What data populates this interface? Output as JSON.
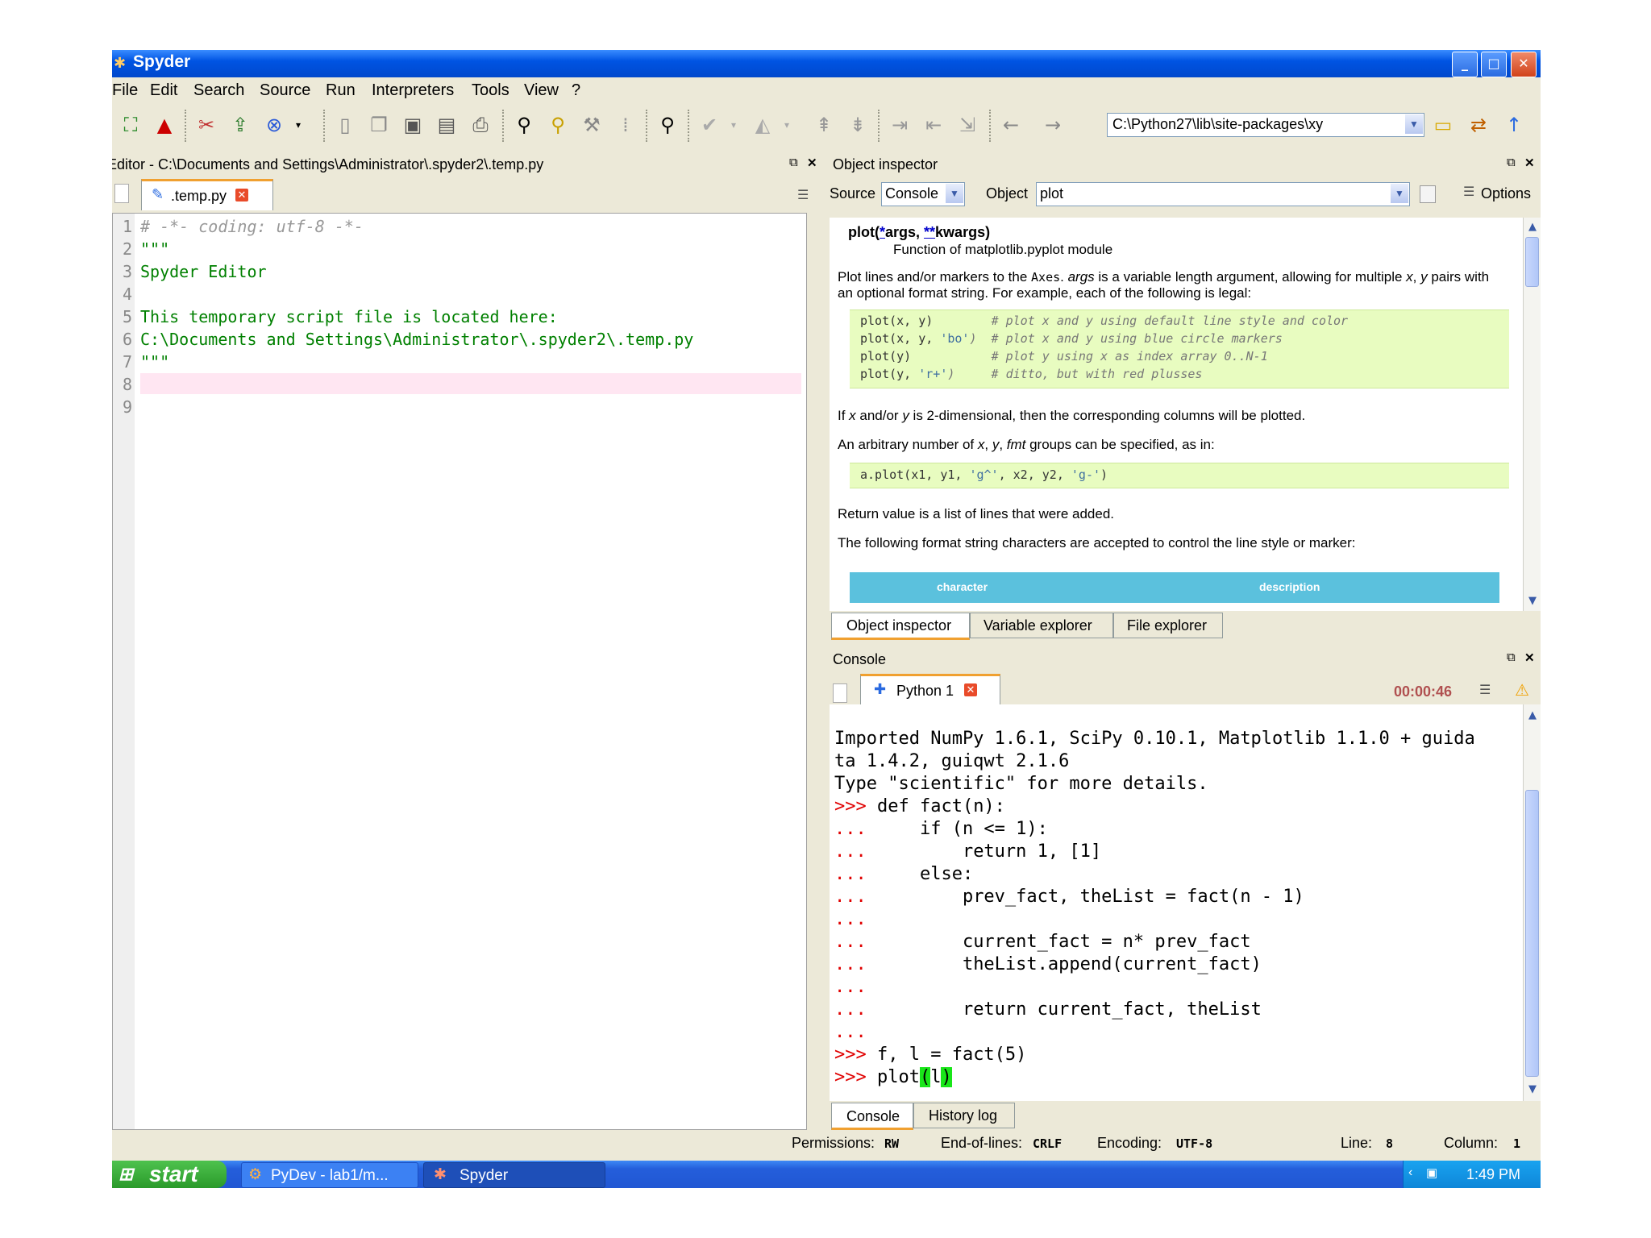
{
  "window": {
    "title": "Spyder"
  },
  "menu": [
    "File",
    "Edit",
    "Search",
    "Source",
    "Run",
    "Interpreters",
    "Tools",
    "View",
    "?"
  ],
  "toolbar": {
    "path": "C:\\Python27\\lib\\site-packages\\xy"
  },
  "editor": {
    "title": "Editor - C:\\Documents and Settings\\Administrator\\.spyder2\\.temp.py",
    "tab": ".temp.py",
    "lines": [
      {
        "n": "1",
        "text": "# -*- coding: utf-8 -*-"
      },
      {
        "n": "2",
        "text": "\"\"\""
      },
      {
        "n": "3",
        "text": "Spyder Editor"
      },
      {
        "n": "4",
        "text": ""
      },
      {
        "n": "5",
        "text": "This temporary script file is located here:"
      },
      {
        "n": "6",
        "text": "C:\\Documents and Settings\\Administrator\\.spyder2\\.temp.py"
      },
      {
        "n": "7",
        "text": "\"\"\""
      },
      {
        "n": "8",
        "text": ""
      },
      {
        "n": "9",
        "text": ""
      }
    ]
  },
  "inspector": {
    "title": "Object inspector",
    "source_label": "Source",
    "source_value": "Console",
    "object_label": "Object",
    "object_value": "plot",
    "options_label": "Options",
    "sig_prefix": "plot(",
    "sig_star": "*",
    "sig_args": "args, ",
    "sig_dstar": "**",
    "sig_kwargs": "kwargs)",
    "subtitle": "Function of matplotlib.pyplot module",
    "p1a": "Plot lines and/or markers to the ",
    "p1_axes": "Axes",
    "p1b": ". ",
    "p1_args": "args",
    "p1c": " is a variable length argument, allowing for multiple ",
    "p1_x": "x",
    "p1d": ", ",
    "p1_y": "y",
    "p1e": " pairs with",
    "p1_line2": "an optional format string. For example, each of the following is legal:",
    "code1": [
      {
        "c": "plot(x, y)        ",
        "s": "",
        "cm": "# plot x and y using default line style and color"
      },
      {
        "c": "plot(x, y, ",
        "s": "'bo'",
        "cm": ")  # plot x and y using blue circle markers"
      },
      {
        "c": "plot(y)           ",
        "s": "",
        "cm": "# plot y using x as index array 0..N-1"
      },
      {
        "c": "plot(y, ",
        "s": "'r+'",
        "cm": ")     # ditto, but with red plusses"
      }
    ],
    "p2a": "If ",
    "p2_x": "x",
    "p2b": " and/or ",
    "p2_y": "y",
    "p2c": " is 2-dimensional, then the corresponding columns will be plotted.",
    "p3a": "An arbitrary number of ",
    "p3_x": "x",
    "p3b": ", ",
    "p3_y": "y",
    "p3c": ", ",
    "p3_fmt": "fmt",
    "p3d": " groups can be specified, as in:",
    "code2a": "a.plot(x1, y1, ",
    "code2s1": "'g^'",
    "code2b": ", x2, y2, ",
    "code2s2": "'g-'",
    "code2c": ")",
    "p4": "Return value is a list of lines that were added.",
    "p5": "The following format string characters are accepted to control the line style or marker:",
    "th_character": "character",
    "th_description": "description"
  },
  "pane_tabs": [
    "Object inspector",
    "Variable explorer",
    "File explorer"
  ],
  "console": {
    "title": "Console",
    "tab": "Python 1",
    "timer": "00:00:46",
    "lines": [
      {
        "p": "",
        "t": "Imported NumPy 1.6.1, SciPy 0.10.1, Matplotlib 1.1.0 + guida"
      },
      {
        "p": "",
        "t": "ta 1.4.2, guiqwt 2.1.6"
      },
      {
        "p": "",
        "t": "Type \"scientific\" for more details."
      },
      {
        "p": ">>> ",
        "t": "def fact(n):"
      },
      {
        "p": "... ",
        "t": "    if (n <= 1):"
      },
      {
        "p": "... ",
        "t": "        return 1, [1]"
      },
      {
        "p": "... ",
        "t": "    else:"
      },
      {
        "p": "... ",
        "t": "        prev_fact, theList = fact(n - 1)"
      },
      {
        "p": "... ",
        "t": ""
      },
      {
        "p": "... ",
        "t": "        current_fact = n* prev_fact"
      },
      {
        "p": "... ",
        "t": "        theList.append(current_fact)"
      },
      {
        "p": "... ",
        "t": ""
      },
      {
        "p": "... ",
        "t": "        return current_fact, theList"
      },
      {
        "p": "... ",
        "t": ""
      },
      {
        "p": ">>> ",
        "t": "f, l = fact(5)"
      }
    ],
    "last_prompt": ">>> ",
    "last_a": "plot",
    "last_open": "(",
    "last_mid": "l",
    "last_close": ")"
  },
  "console_tabs": [
    "Console",
    "History log"
  ],
  "status": {
    "perm_label": "Permissions:",
    "perm": "RW",
    "eol_label": "End-of-lines:",
    "eol": "CRLF",
    "enc_label": "Encoding:",
    "enc": "UTF-8",
    "line_label": "Line:",
    "line": "8",
    "col_label": "Column:",
    "col": "1"
  },
  "taskbar": {
    "start": "start",
    "tasks": [
      "PyDev - lab1/m...",
      "Spyder"
    ],
    "time": "1:49 PM"
  }
}
